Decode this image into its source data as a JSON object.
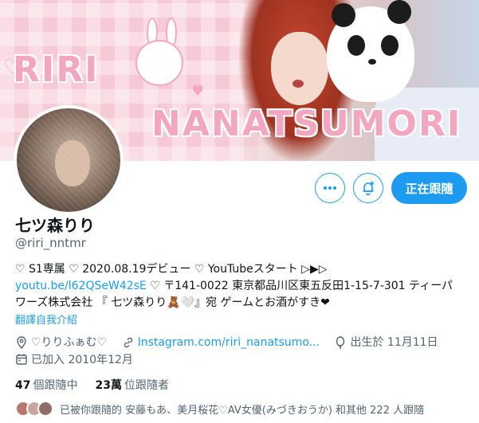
{
  "banner": {
    "line1": "RIRI",
    "line2": "NANATSUMORI"
  },
  "actions": {
    "more_icon": "more-dots-icon",
    "notify_icon": "bell-plus-icon",
    "following_label": "正在跟隨",
    "accent_color": "#1d9bf0"
  },
  "profile": {
    "name": "七ツ森りり",
    "handle": "@riri_nntmr",
    "bio_line1": "♡ S1専属 ♡ 2020.08.19デビュー ♡ YouTubeスタート ▷▶▷",
    "bio_link": "youtu.be/l62QSeW42sE",
    "bio_line2_rest": " ♡ 〒141-0022 東京都品川区東五反田1-15-7-301 ティーパ",
    "bio_line3": "ワーズ株式会社 『 七ツ森りり🧸🤍』宛 ゲームとお酒がすき❤",
    "translate_label": "翻譯自我介紹",
    "location": "♡りりふぁむ♡",
    "website": "Instagram.com/riri_nanatsumo...",
    "birthday": "出生於 11月11日",
    "joined": "已加入 2010年12月"
  },
  "stats": {
    "following_count": "47",
    "following_label": "個跟隨中",
    "followers_count": "23萬",
    "followers_label": "位跟隨者"
  },
  "followed_by": {
    "text": "已被你跟隨的 安藤もあ、美月桜花♡AV女優(みづきおうか) 和其他 222 人跟隨"
  }
}
